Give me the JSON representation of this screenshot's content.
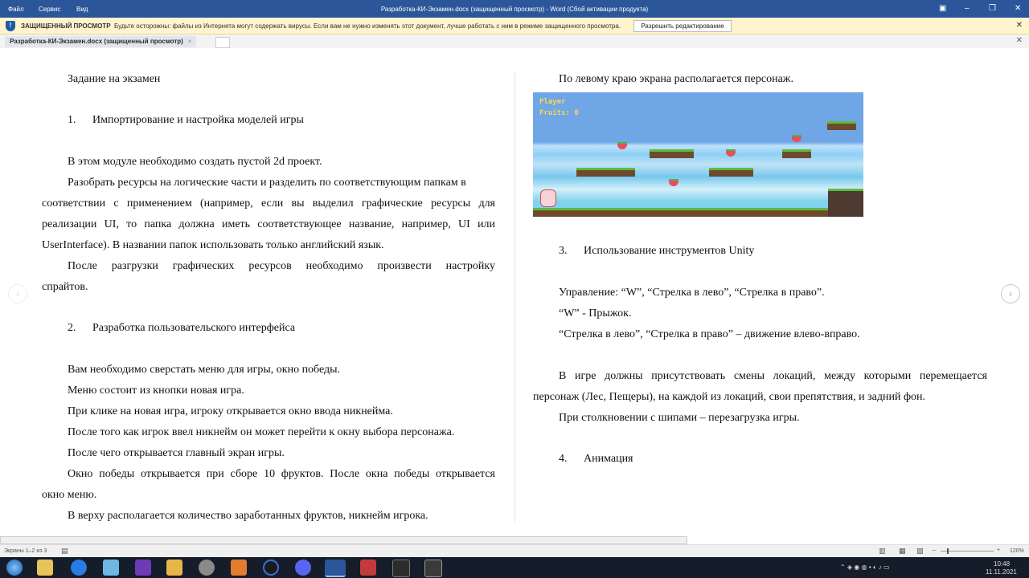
{
  "window": {
    "title": "Разработка-КИ-Экзамен.docx (защищенный просмотр) - Word (Сбой активации продукта)",
    "menu": [
      "Файл",
      "Сервис",
      "Вид"
    ]
  },
  "protected_bar": {
    "label": "ЗАЩИЩЕННЫЙ ПРОСМОТР",
    "message": "Будьте осторожны: файлы из Интернета могут содержать вирусы. Если вам не нужно изменять этот документ, лучше работать с ним в режиме защищенного просмотра.",
    "button": "Разрешить редактирование"
  },
  "doc_tab": {
    "label": "Разработка-КИ-Экзамен.docx (защищенный просмотр)",
    "close": "×"
  },
  "left_column": {
    "heading": "Задание на экзамен",
    "section1_num": "1.",
    "section1_title": "Импортирование и настройка моделей игры",
    "p1": "В этом модуле необходимо создать пустой 2d проект.",
    "p2_line1": "Разобрать ресурсы на логические части и разделить по соответствующим папкам в",
    "p2_line2": "соответствии с применением (например, если вы выделил графические ресурсы для",
    "p2_line3": "реализации UI, то папка должна иметь соответствующее название, например, UI или",
    "p2_line4": "UserInterface). В названии папок использовать только английский язык.",
    "p3_line1": "После разгрузки графических ресурсов необходимо произвести настройку",
    "p3_line2": "спрайтов.",
    "section2_num": "2.",
    "section2_title": "Разработка пользовательского интерфейса",
    "p4": "Вам необходимо сверстать меню для игры, окно победы.",
    "p5": "Меню состоит из кнопки новая игра.",
    "p6": "При клике на новая игра, игроку открывается окно ввода никнейма.",
    "p7": "После того как игрок ввел никнейм он может перейти к окну выбора персонажа.",
    "p8": "После чего открывается главный экран игры.",
    "p9_line1": "Окно победы открывается при сборе 10 фруктов. После окна победы открывается",
    "p9_line2": "окно меню.",
    "p10": "В верху располагается количество заработанных фруктов, никнейм игрока."
  },
  "right_column": {
    "p1": "По левому краю экрана располагается персонаж.",
    "game": {
      "hud_player": "Player",
      "hud_fruits": "Fruits: 0"
    },
    "section3_num": "3.",
    "section3_title": "Использование инструментов Unity",
    "p2": "Управление: “W”, “Стрелка в лево”, “Стрелка в право”.",
    "p3": "“W” - Прыжок.",
    "p4": "“Стрелка в лево”, “Стрелка в право” – движение влево-вправо.",
    "p5_line1": "В игре должны присутствовать смены локаций, между которыми перемещается",
    "p5_line2": "персонаж (Лес, Пещеры), на каждой из локаций, свои препятствия, и задний фон.",
    "p6": "При столкновении с шипами – перезагрузка игры.",
    "section4_num": "4.",
    "section4_title": "Анимация"
  },
  "status": {
    "pages": "Экраны 1–2 из 3",
    "zoom": "120%"
  },
  "taskbar": {
    "time": "10:48",
    "date": "11.11.2021"
  }
}
